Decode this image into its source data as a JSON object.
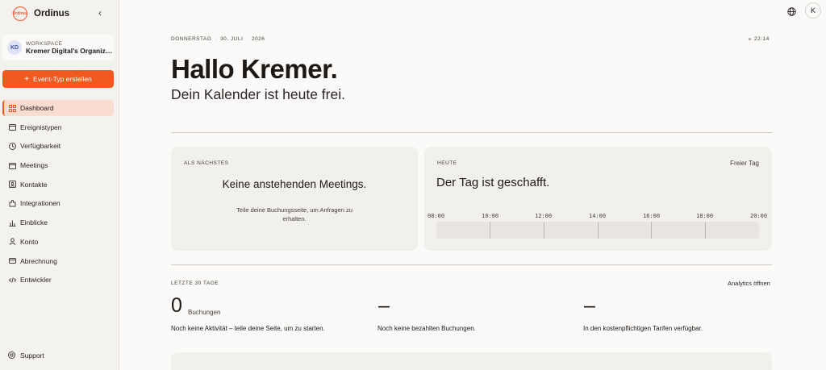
{
  "sidebar": {
    "brand": "Ordinus",
    "logo_text": "Ordinus",
    "collapse_icon": "chevron-left-icon",
    "workspace": {
      "initials": "KD",
      "label": "WORKSPACE",
      "name": "Kremer Digital's Organizat..."
    },
    "create_button": "Event-Typ erstellen",
    "items": [
      {
        "label": "Dashboard",
        "icon": "grid-icon",
        "active": true
      },
      {
        "label": "Ereignistypen",
        "icon": "calendar-icon"
      },
      {
        "label": "Verfügbarkeit",
        "icon": "clock-icon"
      },
      {
        "label": "Meetings",
        "icon": "calendar-icon"
      },
      {
        "label": "Kontakte",
        "icon": "contact-icon"
      },
      {
        "label": "Integrationen",
        "icon": "puzzle-icon"
      },
      {
        "label": "Einblicke",
        "icon": "bar-chart-icon"
      },
      {
        "label": "Konto",
        "icon": "user-icon"
      },
      {
        "label": "Abrechnung",
        "icon": "credit-card-icon"
      },
      {
        "label": "Entwickler",
        "icon": "code-icon"
      }
    ],
    "support": "Support"
  },
  "topbar": {
    "avatar_initial": "K",
    "globe_icon": "globe-icon"
  },
  "header": {
    "weekday": "DONNERSTAG",
    "date": "30. JULI",
    "year": "2026",
    "time": "22:14",
    "greeting": "Hallo Kremer.",
    "subtitle": "Dein Kalender ist heute frei."
  },
  "next_card": {
    "label": "ALS NÄCHSTES",
    "title": "Keine anstehenden Meetings.",
    "subtitle": "Teile deine Buchungsseite, um Anfragen zu erhalten."
  },
  "today_card": {
    "label": "HEUTE",
    "tag": "Freier Tag",
    "title": "Der Tag ist geschafft.",
    "ticks": [
      "08:00",
      "10:00",
      "12:00",
      "14:00",
      "16:00",
      "18:00",
      "20:00"
    ]
  },
  "stats": {
    "label": "LETZTE 30 TAGE",
    "analytics_link": "Analytics öffnen",
    "items": [
      {
        "value": "0",
        "unit": "Buchungen",
        "desc": "Noch keine Aktivität – teile deine Seite, um zu starten."
      },
      {
        "value": "–",
        "unit": "",
        "desc": "Noch keine bezahlten Buchungen."
      },
      {
        "value": "–",
        "unit": "",
        "desc": "In den kostenpflichtigen Tarifen verfügbar."
      }
    ]
  },
  "colors": {
    "accent": "#f05a1e",
    "active_bg": "#f9ddd1",
    "background": "#fbfaf8",
    "sidebar_bg": "#f4f2ef",
    "card_bg": "#f2f0ec"
  }
}
